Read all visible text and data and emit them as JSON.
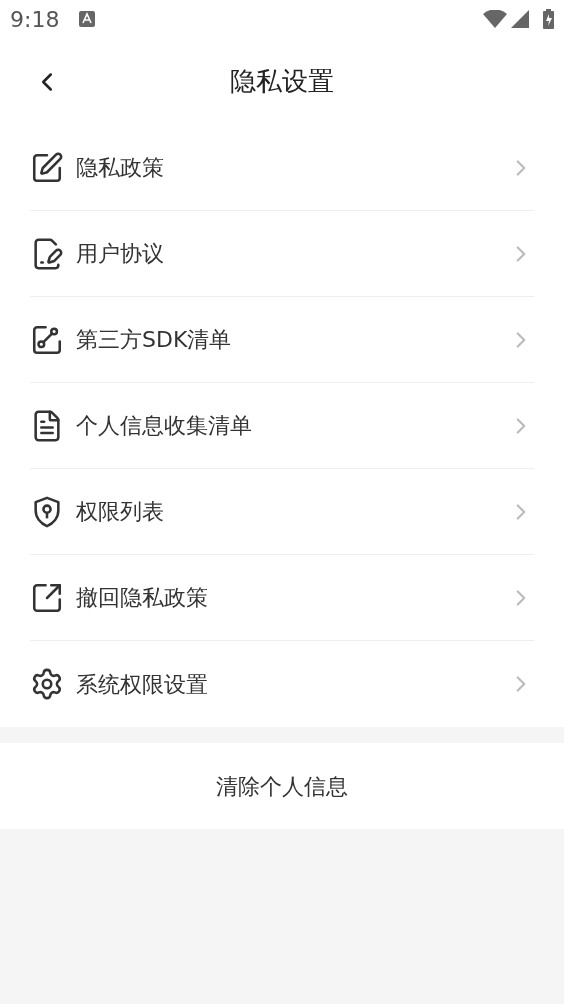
{
  "status_bar": {
    "time": "9:18"
  },
  "header": {
    "title": "隐私设置"
  },
  "items": [
    {
      "label": "隐私政策",
      "kind": "quill"
    },
    {
      "label": "用户协议",
      "kind": "signature"
    },
    {
      "label": "第三方SDK清单",
      "kind": "share"
    },
    {
      "label": "个人信息收集清单",
      "kind": "document"
    },
    {
      "label": "权限列表",
      "kind": "shield"
    },
    {
      "label": "撤回隐私政策",
      "kind": "revoke"
    },
    {
      "label": "系统权限设置",
      "kind": "gear"
    }
  ],
  "clear_button": {
    "label": "清除个人信息"
  }
}
